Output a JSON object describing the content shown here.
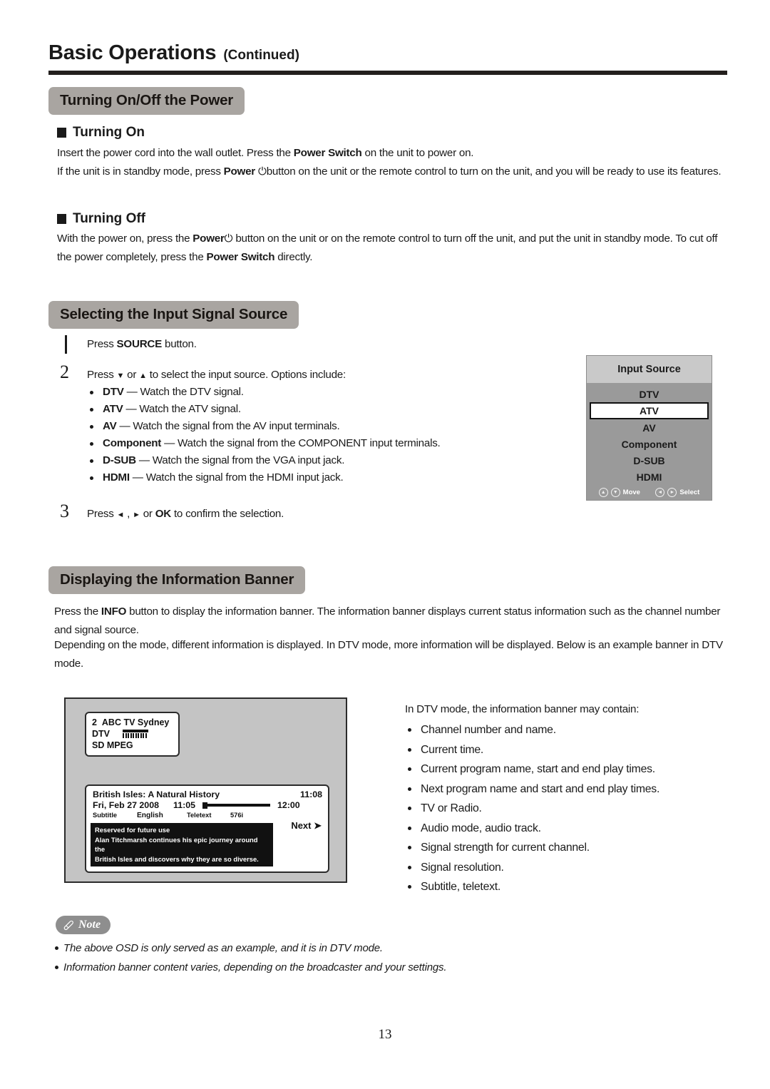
{
  "header": {
    "title_main": "Basic Operations",
    "title_sub": "(Continued)"
  },
  "sections": {
    "power": {
      "pill": "Turning On/Off the Power",
      "turning_on": {
        "heading": "Turning On",
        "para1_a": "Insert the power cord into the wall outlet. Press the ",
        "para1_b": "Power Switch",
        "para1_c": " on the unit to power on.",
        "para2_a": "If the unit is in standby mode, press ",
        "para2_b": "Power",
        "para2_icon": "⏻",
        "para2_c": "button on the unit or the remote control to turn on the unit, and you will be ready to use its features."
      },
      "turning_off": {
        "heading": "Turning Off",
        "para_a": "With the power on, press the ",
        "para_b": "Power",
        "para_icon": "⏻",
        "para_c": " button on the unit or on the remote control to turn off the unit, and put the unit in standby mode. To cut off the power completely, press the ",
        "para_d": "Power Switch",
        "para_e": " directly."
      }
    },
    "input_source": {
      "pill": "Selecting the Input Signal Source",
      "step1": {
        "number": "1",
        "text_a": "Press ",
        "text_b": "SOURCE",
        "text_c": " button."
      },
      "step2": {
        "number": "2",
        "intro_a": "Press ",
        "intro_down": "▼",
        "intro_or": " or ",
        "intro_up": "▲",
        "intro_b": " to select the input source. Options include:",
        "options": [
          {
            "name": "DTV",
            "desc": " — Watch the DTV signal."
          },
          {
            "name": "ATV",
            "desc": " — Watch the ATV signal."
          },
          {
            "name": "AV",
            "desc": " — Watch the signal from the AV input terminals."
          },
          {
            "name": "Component",
            "desc": " — Watch the signal from the COMPONENT input terminals."
          },
          {
            "name": "D-SUB",
            "desc": " — Watch the signal from the VGA input jack."
          },
          {
            "name": "HDMI",
            "desc": " — Watch the signal from the HDMI input jack."
          }
        ]
      },
      "step3": {
        "number": "3",
        "text_a": "Press ",
        "arrow_left": "◄",
        "text_comma": " , ",
        "arrow_right": "►",
        "text_or": " or ",
        "text_ok": "OK",
        "text_b": " to confirm the selection."
      },
      "osd": {
        "title": "Input Source",
        "items": [
          "DTV",
          "ATV",
          "AV",
          "Component",
          "D-SUB",
          "HDMI"
        ],
        "selected": "ATV",
        "footer": [
          {
            "keys": [
              "▲",
              "▼"
            ],
            "label": "Move"
          },
          {
            "keys": [
              "◄",
              "►"
            ],
            "label": "Select"
          }
        ]
      }
    },
    "info_banner": {
      "pill": "Displaying the Information Banner",
      "para1_a": "Press the ",
      "para1_b": "INFO",
      "para1_c": " button to display the information banner. The information banner displays current status information such as the channel number and signal source.",
      "para2": "Depending on the mode, different information is displayed. In DTV mode, more information will be displayed. Below is an example banner in DTV mode.",
      "list_intro": "In DTV mode, the information banner may contain:",
      "list_items": [
        "Channel number and name.",
        "Current time.",
        "Current program name, start and end play times.",
        "Next program name and start and end play times.",
        "TV or Radio.",
        "Audio mode, audio track.",
        "Signal strength for current channel.",
        "Signal resolution.",
        "Subtitle, teletext."
      ]
    }
  },
  "tv_mock": {
    "channel_box": {
      "channel_number": "2",
      "channel_name": "ABC TV Sydney",
      "mode": "DTV",
      "format_line": "SD  MPEG"
    },
    "info_box": {
      "program_title": "British Isles: A Natural History",
      "current_time": "11:08",
      "date": "Fri, Feb 27 2008",
      "start_time": "11:05",
      "end_time": "12:00",
      "next_label": "Next ➤",
      "tags": {
        "subtitle": "Subtitle",
        "language": "English",
        "teletext": "Teletext",
        "resolution": "576i"
      },
      "description_line1": "Reserved for future use",
      "description_line2": "Alan Titchmarsh continues his epic journey around the",
      "description_line3": "British Isles and discovers why they are so diverse."
    }
  },
  "note": {
    "label": "Note",
    "icon": "pencil-icon",
    "items": [
      "The above OSD is only served as an example, and it is in DTV mode.",
      "Information banner content varies, depending on the broadcaster and your settings."
    ]
  },
  "page_number": "13",
  "colors": {
    "pill_gray": "#a9a5a1",
    "osd_body": "#9a9a9a",
    "osd_header": "#c9c9c9",
    "mock_bg": "#c4c4c4",
    "note_gray": "#8e8e8e",
    "ink": "#1a1a1a"
  }
}
